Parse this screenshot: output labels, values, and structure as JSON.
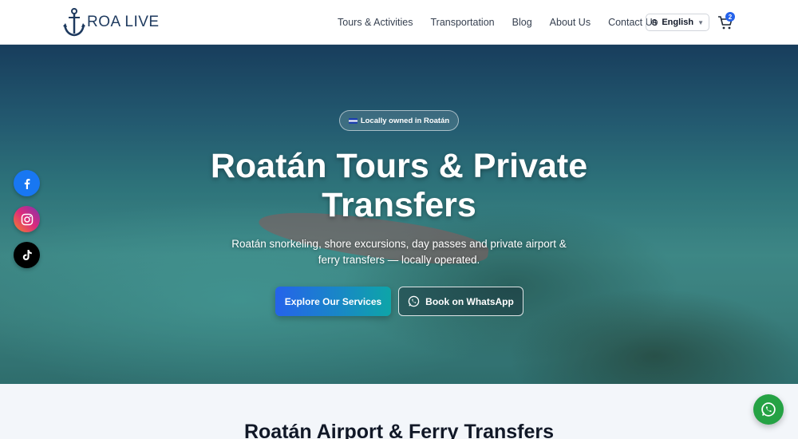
{
  "brand": {
    "name": "ROA LIVE",
    "icon": "anchor-icon",
    "color": "#1e3a5f"
  },
  "nav": {
    "items": [
      {
        "label": "Tours & Activities"
      },
      {
        "label": "Transportation"
      },
      {
        "label": "Blog"
      },
      {
        "label": "About Us"
      },
      {
        "label": "Contact Us"
      }
    ]
  },
  "language": {
    "selected": "English",
    "icon": "globe-icon"
  },
  "cart": {
    "count": "2",
    "icon": "cart-icon",
    "badge_color": "#2563eb"
  },
  "hero": {
    "badge": "Locally owned in Roatán",
    "title": "Roatán Tours & Private Transfers",
    "subtitle": "Roatán snorkeling, shore excursions, day passes and private airport & ferry transfers — locally operated.",
    "primary_button": "Explore Our Services",
    "secondary_button": "Book on WhatsApp"
  },
  "social": [
    {
      "name": "facebook",
      "icon": "facebook-icon",
      "color": "#1877f2"
    },
    {
      "name": "instagram",
      "icon": "instagram-icon",
      "color": "#dd2a7b"
    },
    {
      "name": "tiktok",
      "icon": "tiktok-icon",
      "color": "#000000"
    }
  ],
  "section": {
    "title": "Roatán Airport & Ferry Transfers"
  },
  "whatsapp_float": {
    "icon": "whatsapp-icon",
    "color": "#25a244"
  }
}
